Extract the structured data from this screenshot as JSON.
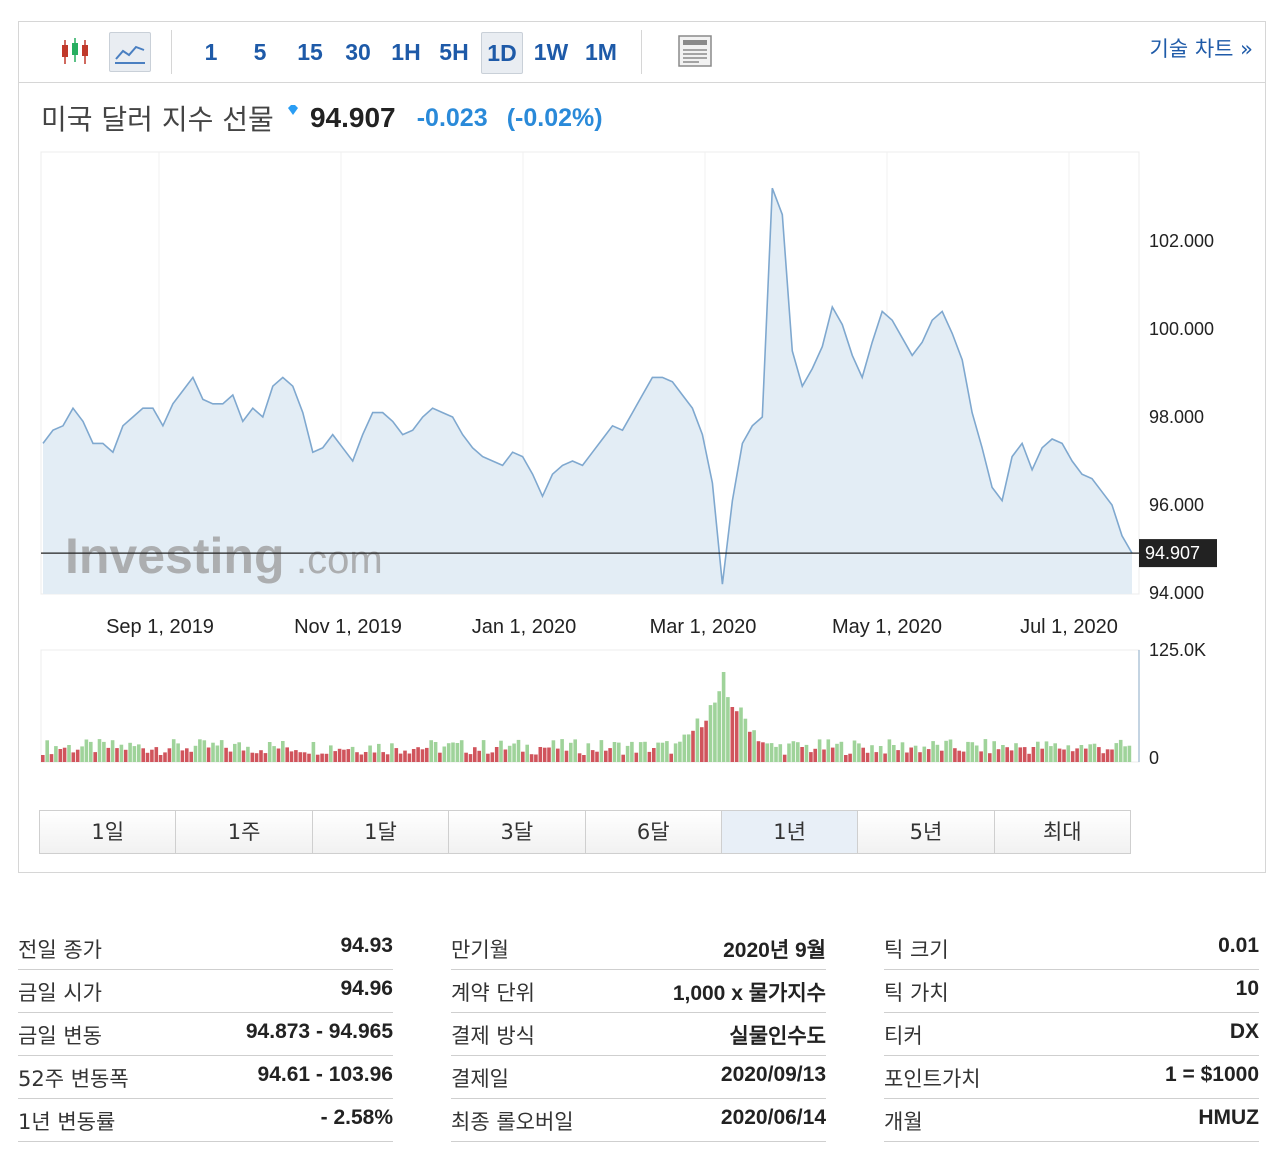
{
  "toolbar": {
    "intervals": [
      {
        "label": "1"
      },
      {
        "label": "5"
      },
      {
        "label": "15"
      },
      {
        "label": "30"
      },
      {
        "label": "1H"
      },
      {
        "label": "5H"
      },
      {
        "label": "1D",
        "active": true
      },
      {
        "label": "1W"
      },
      {
        "label": "1M"
      }
    ],
    "tech_chart_link": "기술 차트 »"
  },
  "header": {
    "title": "미국 달러 지수 선물",
    "price": "94.907",
    "change": "-0.023",
    "change_pct": "(-0.02%)",
    "change_color": "#2a8ad9"
  },
  "watermark": "Investing.com",
  "chart_data": {
    "type": "area",
    "y_ticks": [
      "102.000",
      "100.000",
      "98.000",
      "96.000",
      "94.000"
    ],
    "x_ticks": [
      "Sep 1, 2019",
      "Nov 1, 2019",
      "Jan 1, 2020",
      "Mar 1, 2020",
      "May 1, 2020",
      "Jul 1, 2020"
    ],
    "ylim": [
      94.0,
      102.0
    ],
    "last_price_label": "94.907",
    "volume_ticks": [
      "125.0K",
      "0"
    ],
    "volume_peak_index": 79,
    "series": [
      {
        "values": [
          97.4,
          97.7,
          97.8,
          98.2,
          97.9,
          97.4,
          97.4,
          97.2,
          97.8,
          98.0,
          98.2,
          98.2,
          97.8,
          98.3,
          98.6,
          98.9,
          98.4,
          98.3,
          98.3,
          98.5,
          97.9,
          98.2,
          98.0,
          98.7,
          98.9,
          98.7,
          98.1,
          97.2,
          97.3,
          97.6,
          97.3,
          97.0,
          97.6,
          98.1,
          98.1,
          97.9,
          97.6,
          97.7,
          98.0,
          98.2,
          98.1,
          98.0,
          97.6,
          97.3,
          97.1,
          97.0,
          96.9,
          97.2,
          97.1,
          96.7,
          96.2,
          96.7,
          96.9,
          97.0,
          96.9,
          97.2,
          97.5,
          97.8,
          97.7,
          98.1,
          98.5,
          98.9,
          98.9,
          98.8,
          98.5,
          98.2,
          97.6,
          96.5,
          94.2,
          96.1,
          97.4,
          97.8,
          98.0,
          103.2,
          102.6,
          99.5,
          98.7,
          99.1,
          99.6,
          100.5,
          100.1,
          99.4,
          98.9,
          99.7,
          100.4,
          100.2,
          99.8,
          99.4,
          99.7,
          100.2,
          100.4,
          99.9,
          99.3,
          98.1,
          97.3,
          96.4,
          96.1,
          97.1,
          97.4,
          96.8,
          97.3,
          97.5,
          97.4,
          97.0,
          96.7,
          96.6,
          96.3,
          96.0,
          95.3,
          94.907
        ]
      }
    ]
  },
  "ranges": [
    {
      "label": "1일"
    },
    {
      "label": "1주"
    },
    {
      "label": "1달"
    },
    {
      "label": "3달"
    },
    {
      "label": "6달"
    },
    {
      "label": "1년",
      "active": true
    },
    {
      "label": "5년"
    },
    {
      "label": "최대"
    }
  ],
  "stats": {
    "col1": [
      {
        "label": "전일 종가",
        "value": "94.93"
      },
      {
        "label": "금일 시가",
        "value": "94.96"
      },
      {
        "label": "금일 변동",
        "value": "94.873 - 94.965"
      },
      {
        "label": "52주 변동폭",
        "value": "94.61 - 103.96"
      },
      {
        "label": "1년 변동률",
        "value": "- 2.58%"
      }
    ],
    "col2": [
      {
        "label": "만기월",
        "value": "2020년 9월"
      },
      {
        "label": "계약 단위",
        "value": "1,000 x 물가지수"
      },
      {
        "label": "결제 방식",
        "value": "실물인수도"
      },
      {
        "label": "결제일",
        "value": "2020/09/13"
      },
      {
        "label": "최종 롤오버일",
        "value": "2020/06/14"
      }
    ],
    "col3": [
      {
        "label": "틱 크기",
        "value": "0.01"
      },
      {
        "label": "틱 가치",
        "value": "10"
      },
      {
        "label": "티커",
        "value": "DX"
      },
      {
        "label": "포인트가치",
        "value": "1 = $1000"
      },
      {
        "label": "개월",
        "value": "HMUZ"
      }
    ]
  }
}
